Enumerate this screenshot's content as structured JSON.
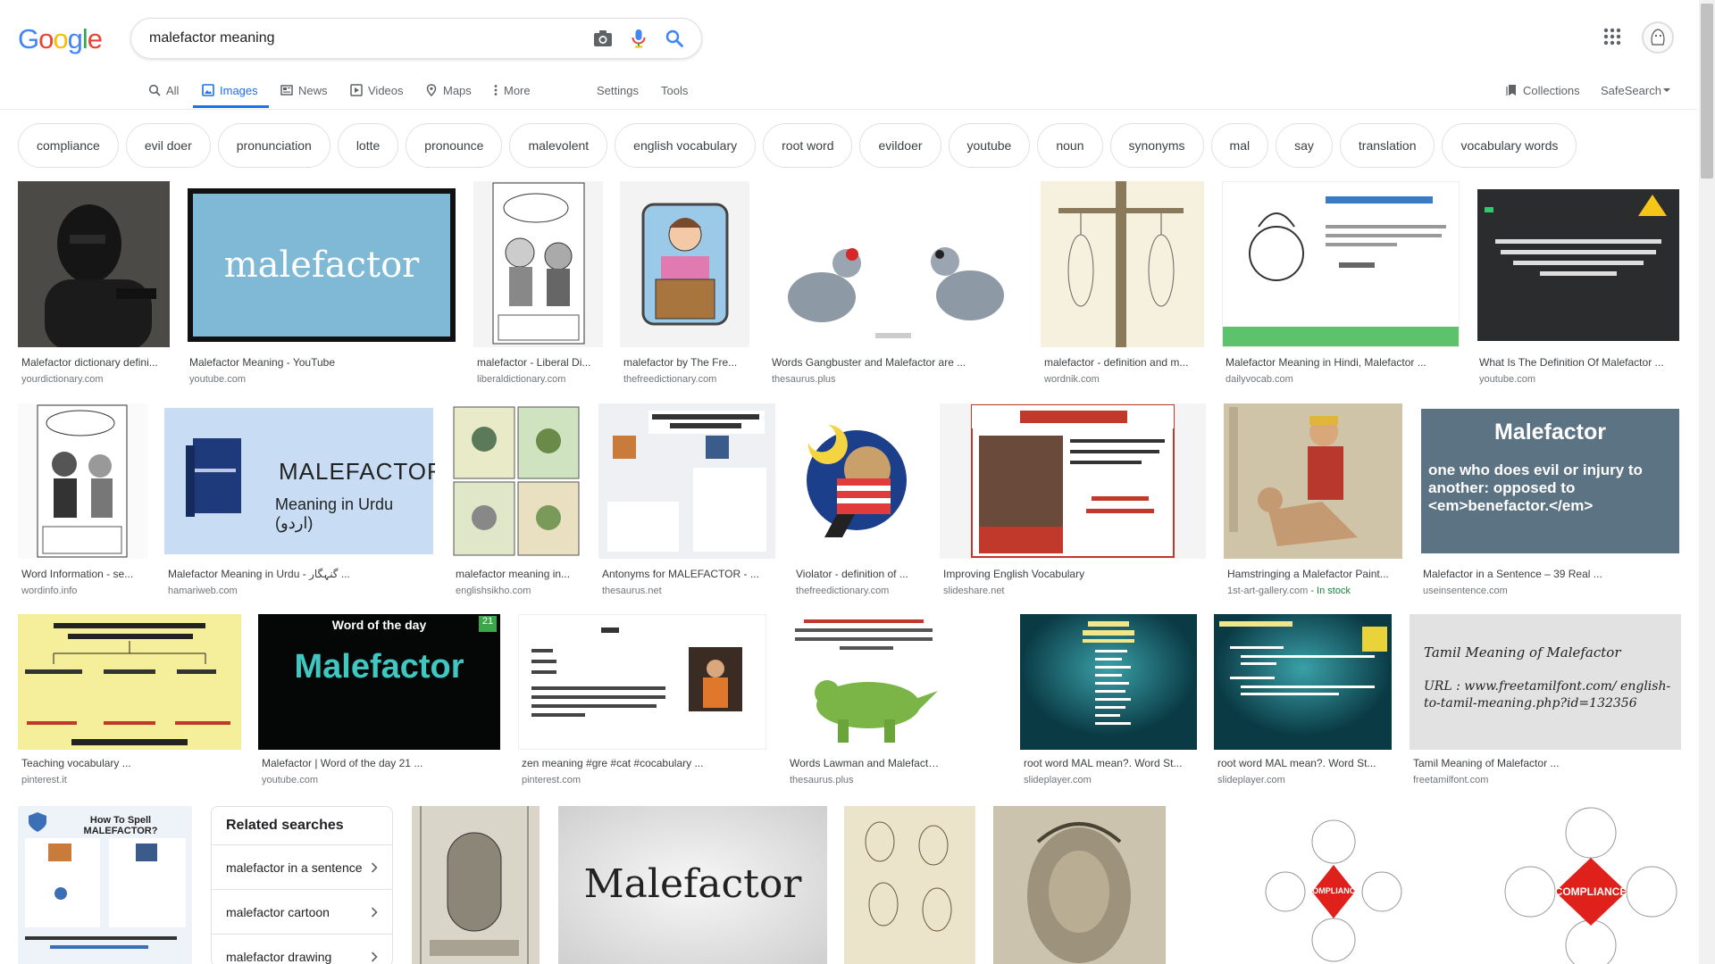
{
  "logo": {
    "g1": "G",
    "o1": "o",
    "o2": "o",
    "g2": "g",
    "l": "l",
    "e": "e"
  },
  "search": {
    "query": "malefactor meaning"
  },
  "tabs": {
    "all": "All",
    "images": "Images",
    "news": "News",
    "videos": "Videos",
    "maps": "Maps",
    "more": "More",
    "settings": "Settings",
    "tools": "Tools",
    "collections": "Collections",
    "safesearch": "SafeSearch"
  },
  "chips": [
    "compliance",
    "evil doer",
    "pronunciation",
    "lotte",
    "pronounce",
    "malevolent",
    "english vocabulary",
    "root word",
    "evildoer",
    "youtube",
    "noun",
    "synonyms",
    "mal",
    "say",
    "translation",
    "vocabulary words"
  ],
  "results": [
    {
      "title": "Malefactor dictionary defini...",
      "source": "yourdictionary.com"
    },
    {
      "title": "Malefactor Meaning - YouTube",
      "source": "youtube.com",
      "art": "malefactor"
    },
    {
      "title": "malefactor - Liberal Di...",
      "source": "liberaldictionary.com"
    },
    {
      "title": "malefactor by The Fre...",
      "source": "thefreedictionary.com"
    },
    {
      "title": "Words Gangbuster and Malefactor are ...",
      "source": "thesaurus.plus"
    },
    {
      "title": "malefactor - definition and m...",
      "source": "wordnik.com"
    },
    {
      "title": "Malefactor Meaning in Hindi, Malefactor ...",
      "source": "dailyvocab.com"
    },
    {
      "title": "What Is The Definition Of Malefactor ...",
      "source": "youtube.com"
    },
    {
      "title": "Word Information - se...",
      "source": "wordinfo.info"
    },
    {
      "title": "Malefactor Meaning in Urdu - گنہگار ...",
      "source": "hamariweb.com",
      "art1": "MALEFACTOR",
      "art2": "Meaning in Urdu (اردو)"
    },
    {
      "title": "malefactor meaning in...",
      "source": "englishsikho.com"
    },
    {
      "title": "Antonyms for MALEFACTOR - ...",
      "source": "thesaurus.net"
    },
    {
      "title": "Violator - definition of ...",
      "source": "thefreedictionary.com"
    },
    {
      "title": "Improving English Vocabulary",
      "source": "slideshare.net"
    },
    {
      "title": "Hamstringing a Malefactor Paint...",
      "source": "1st-art-gallery.com",
      "stock": " - In stock"
    },
    {
      "title": "Malefactor in a Sentence – 39 Real ...",
      "source": "useinsentence.com",
      "art1": "Malefactor",
      "art2": "one who does evil or injury to another: opposed to <em>benefactor.</em>"
    },
    {
      "title": "Teaching vocabulary ...",
      "source": "pinterest.it"
    },
    {
      "title": "Malefactor | Word of the day 21 ...",
      "source": "youtube.com",
      "art1": "Word of the day",
      "art2": "Malefactor"
    },
    {
      "title": "zen meaning #gre #cat #cocabulary ...",
      "source": "pinterest.com"
    },
    {
      "title": "Words Lawman and Malefactor are ...",
      "source": "thesaurus.plus"
    },
    {
      "title": "root word MAL mean?. Word St...",
      "source": "slideplayer.com"
    },
    {
      "title": "root word MAL mean?. Word St...",
      "source": "slideplayer.com"
    },
    {
      "title": "Tamil Meaning of Malefactor ...",
      "source": "freetamilfont.com",
      "art1": "Tamil Meaning of Malefactor",
      "art2": "URL : www.freetamilfont.com/ english-to-tamil-meaning.php?id=132356"
    }
  ],
  "bottom_art": {
    "malefactor": "Malefactor",
    "spell": "How To Spell MALEFACTOR?",
    "compliance": "COMPLIANCE"
  },
  "related": {
    "heading": "Related searches",
    "items": [
      "malefactor in a sentence",
      "malefactor cartoon",
      "malefactor drawing"
    ]
  },
  "colors": {
    "blue": "#4285F4",
    "red": "#EA4335",
    "yellow": "#FBBC05",
    "green": "#34A853",
    "accent": "#1a73e8"
  }
}
